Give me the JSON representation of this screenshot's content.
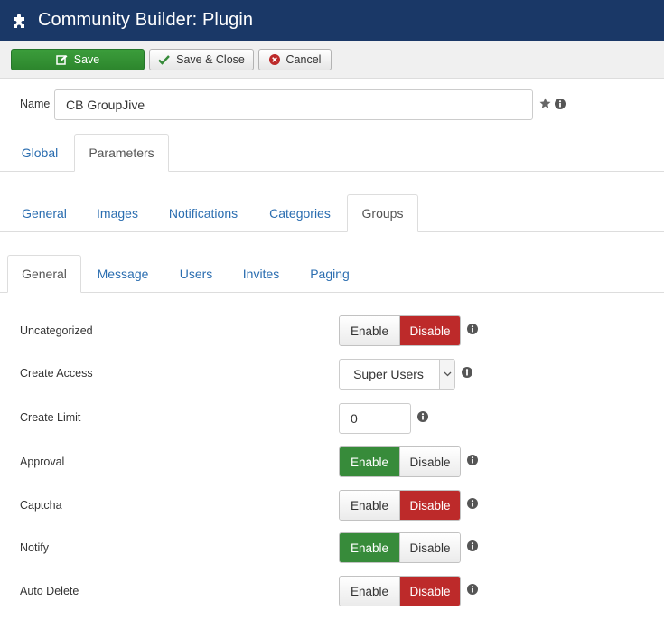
{
  "window": {
    "title": "Community Builder: Plugin"
  },
  "toolbar": {
    "save_label": "Save",
    "save_close_label": "Save & Close",
    "cancel_label": "Cancel"
  },
  "name": {
    "label": "Name",
    "value": "CB GroupJive"
  },
  "tabs_level1": [
    "Global",
    "Parameters"
  ],
  "tabs_level2": [
    "General",
    "Images",
    "Notifications",
    "Categories",
    "Groups"
  ],
  "tabs_level3": [
    "General",
    "Message",
    "Users",
    "Invites",
    "Paging"
  ],
  "toggle_labels": {
    "enable": "Enable",
    "disable": "Disable"
  },
  "fields": {
    "uncategorized": {
      "label": "Uncategorized",
      "value": "Disable"
    },
    "create_access": {
      "label": "Create Access",
      "value": "Super Users"
    },
    "create_limit": {
      "label": "Create Limit",
      "value": "0"
    },
    "approval": {
      "label": "Approval",
      "value": "Enable"
    },
    "captcha": {
      "label": "Captcha",
      "value": "Disable"
    },
    "notify": {
      "label": "Notify",
      "value": "Enable"
    },
    "auto_delete": {
      "label": "Auto Delete",
      "value": "Disable"
    }
  },
  "colors": {
    "header": "#1a3867",
    "save": "#2d862d",
    "enable_on": "#378b3a",
    "disable_on": "#bd2a2a",
    "link": "#2a6db0"
  },
  "icons": [
    "puzzle-icon",
    "edit-icon",
    "check-icon",
    "cancel-icon",
    "star-icon",
    "info-icon",
    "chevron-down-icon"
  ]
}
